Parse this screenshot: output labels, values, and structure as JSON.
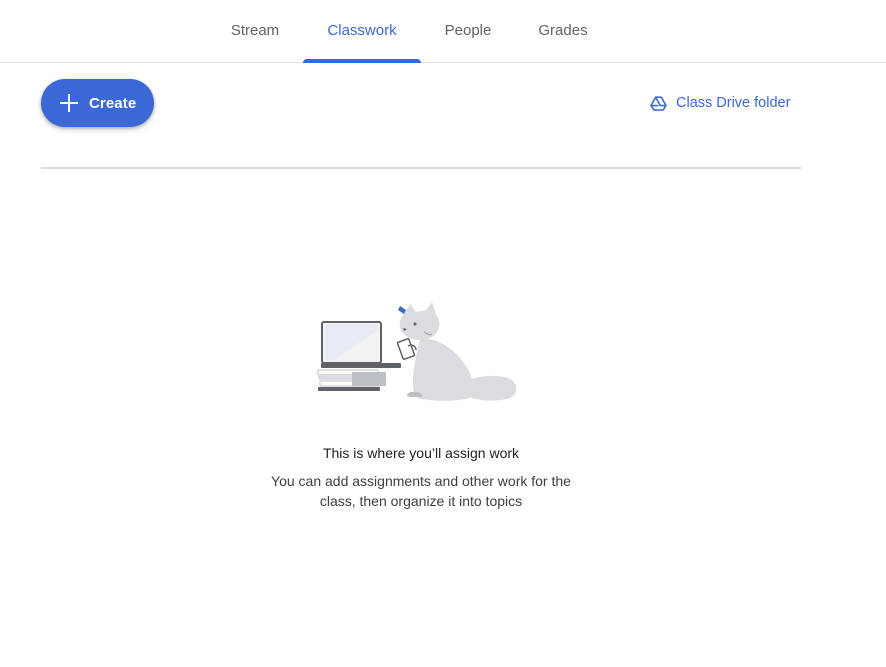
{
  "nav": {
    "tabs": [
      {
        "label": "Stream",
        "active": false
      },
      {
        "label": "Classwork",
        "active": true
      },
      {
        "label": "People",
        "active": false
      },
      {
        "label": "Grades",
        "active": false
      }
    ]
  },
  "toolbar": {
    "create_label": "Create",
    "create_icon": "plus-icon",
    "drive_label": "Class Drive folder",
    "drive_icon": "google-drive-icon"
  },
  "empty_state": {
    "illustration": "cat-with-laptop-illustration",
    "title": "This is where you’ll assign work",
    "description": "You can add assignments and other work for the class, then organize it into topics"
  },
  "colors": {
    "accent": "#3c67d6",
    "divider": "#dadce0",
    "text": "#3c4043",
    "muted": "#5f6368"
  }
}
